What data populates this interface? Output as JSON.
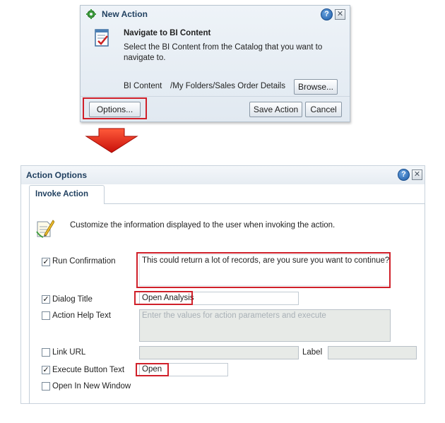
{
  "new_action_dialog": {
    "title": "New Action",
    "heading": "Navigate to BI Content",
    "description": "Select the BI Content from the Catalog that you want to navigate to.",
    "bi_content_label": "BI Content",
    "bi_content_value": "/My Folders/Sales Order Details",
    "browse_label": "Browse...",
    "options_label": "Options...",
    "save_action_label": "Save Action",
    "cancel_label": "Cancel"
  },
  "action_options_dialog": {
    "title": "Action Options",
    "tab_label": "Invoke Action",
    "intro": "Customize the information displayed to the user when invoking the action.",
    "run_confirmation": {
      "label": "Run Confirmation",
      "checked": true,
      "value": "This could return a lot of records, are you sure you want to continue?"
    },
    "dialog_title": {
      "label": "Dialog Title",
      "checked": true,
      "value": "Open Analysis"
    },
    "action_help_text": {
      "label": "Action Help Text",
      "checked": false,
      "placeholder": "Enter the values for action parameters and execute"
    },
    "link_url": {
      "label": "Link URL",
      "checked": false,
      "value": "",
      "label_field_label": "Label",
      "label_value": ""
    },
    "execute_button_text": {
      "label": "Execute Button Text",
      "checked": true,
      "value": "Open"
    },
    "open_in_new_window": {
      "label": "Open In New Window",
      "checked": false
    }
  },
  "icons": {
    "help": "help-icon",
    "close": "close-icon",
    "gear": "gear-icon",
    "document": "document-icon",
    "edit": "edit-icon",
    "arrow": "down-arrow-icon"
  },
  "colors": {
    "highlight": "#d0202a",
    "title_text": "#1f3f5f"
  }
}
